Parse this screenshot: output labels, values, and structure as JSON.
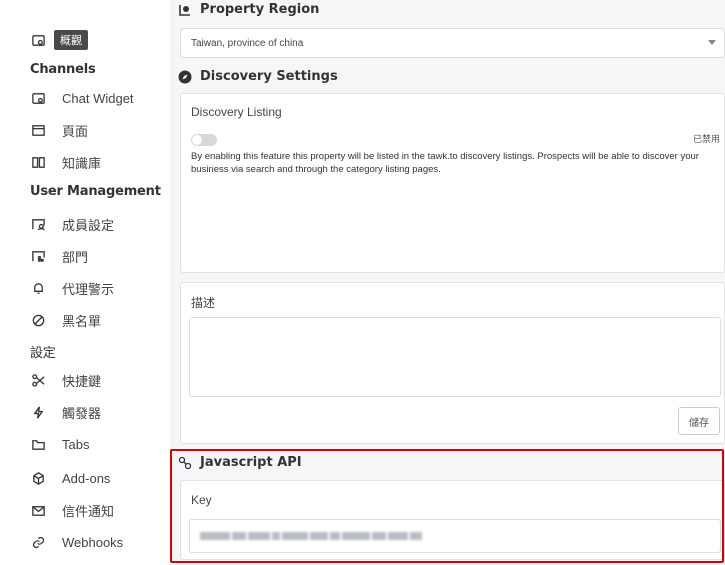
{
  "sidebar": {
    "items": [
      {
        "label": "概觀",
        "icon": "dashboard-icon",
        "style": "pill"
      },
      {
        "header": "Channels"
      },
      {
        "label": "Chat Widget",
        "icon": "chat-widget-icon"
      },
      {
        "label": "頁面",
        "icon": "page-icon"
      },
      {
        "label": "知識庫",
        "icon": "book-icon"
      },
      {
        "header": "User Management"
      },
      {
        "label": "成員設定",
        "icon": "members-icon"
      },
      {
        "label": "部門",
        "icon": "department-icon"
      },
      {
        "label": "代理警示",
        "icon": "bell-icon"
      },
      {
        "label": "黑名單",
        "icon": "ban-icon"
      },
      {
        "header": "設定"
      },
      {
        "label": "快捷鍵",
        "icon": "scissors-icon"
      },
      {
        "label": "觸發器",
        "icon": "lightning-icon"
      },
      {
        "label": "Tabs",
        "icon": "folder-icon"
      },
      {
        "label": "Add-ons",
        "icon": "cube-icon"
      },
      {
        "label": "信件通知",
        "icon": "mail-icon"
      },
      {
        "label": "Webhooks",
        "icon": "link-icon"
      }
    ]
  },
  "main": {
    "property_region": {
      "title": "Property Region",
      "selected": "Taiwan, province of china"
    },
    "discovery": {
      "title": "Discovery Settings",
      "listing_label": "Discovery Listing",
      "toggle_state": "已禁用",
      "description": "By enabling this feature this property will be listed in the tawk.to discovery listings. Prospects will be able to discover your business via search and through the category listing pages."
    },
    "description_box": {
      "label": "描述",
      "value": "",
      "save_label": "儲存"
    },
    "javascript_api": {
      "title": "Javascript API",
      "key_label": "Key",
      "key_value": ""
    }
  },
  "colors": {
    "highlight_border": "#dd0000",
    "main_background": "#f5f6f7"
  }
}
